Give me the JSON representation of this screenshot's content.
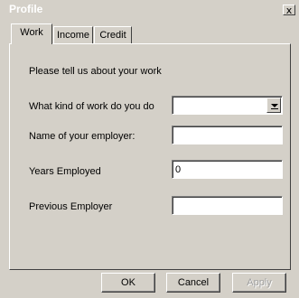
{
  "window": {
    "title": "Profile",
    "close_label": "x"
  },
  "tabs": [
    {
      "label": "Work",
      "active": true
    },
    {
      "label": "Income",
      "active": false
    },
    {
      "label": "Credit",
      "active": false
    }
  ],
  "work": {
    "intro": "Please tell us about your work",
    "kind_label": "What kind of work do you do",
    "kind_value": "",
    "employer_label": "Name of your employer:",
    "employer_value": "",
    "years_label": "Years Employed",
    "years_value": "0",
    "previous_label": "Previous Employer",
    "previous_value": ""
  },
  "buttons": {
    "ok": "OK",
    "cancel": "Cancel",
    "apply": "Apply",
    "apply_enabled": false
  }
}
